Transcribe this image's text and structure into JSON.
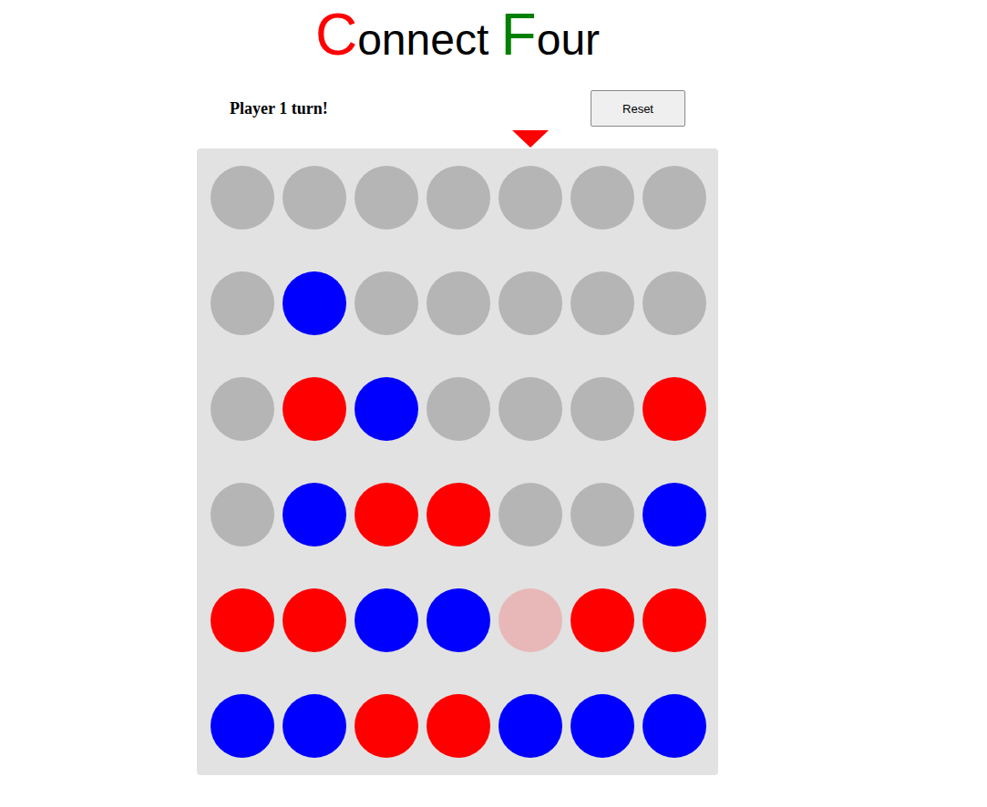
{
  "title": [
    {
      "text": "C",
      "kind": "initial",
      "color": "#ff0000"
    },
    {
      "text": "onnect ",
      "kind": "rest",
      "color": "#000000"
    },
    {
      "text": "F",
      "kind": "initial",
      "color": "#008000"
    },
    {
      "text": "our",
      "kind": "rest",
      "color": "#000000"
    }
  ],
  "turn": {
    "label": "Player 1 turn!",
    "color": "#ff0000"
  },
  "reset_button": {
    "label": "Reset"
  },
  "columns": [
    {
      "hovered": false
    },
    {
      "hovered": false
    },
    {
      "hovered": false
    },
    {
      "hovered": false
    },
    {
      "hovered": true
    },
    {
      "hovered": false
    },
    {
      "hovered": false
    }
  ],
  "board": [
    [
      "empty",
      "empty",
      "empty",
      "empty",
      "empty",
      "empty",
      "empty"
    ],
    [
      "empty",
      "blue",
      "empty",
      "empty",
      "empty",
      "empty",
      "empty"
    ],
    [
      "empty",
      "red",
      "blue",
      "empty",
      "empty",
      "empty",
      "red"
    ],
    [
      "empty",
      "blue",
      "red",
      "red",
      "empty",
      "empty",
      "blue"
    ],
    [
      "red",
      "red",
      "blue",
      "blue",
      "preview",
      "red",
      "red"
    ],
    [
      "blue",
      "blue",
      "red",
      "red",
      "blue",
      "blue",
      "blue"
    ]
  ]
}
